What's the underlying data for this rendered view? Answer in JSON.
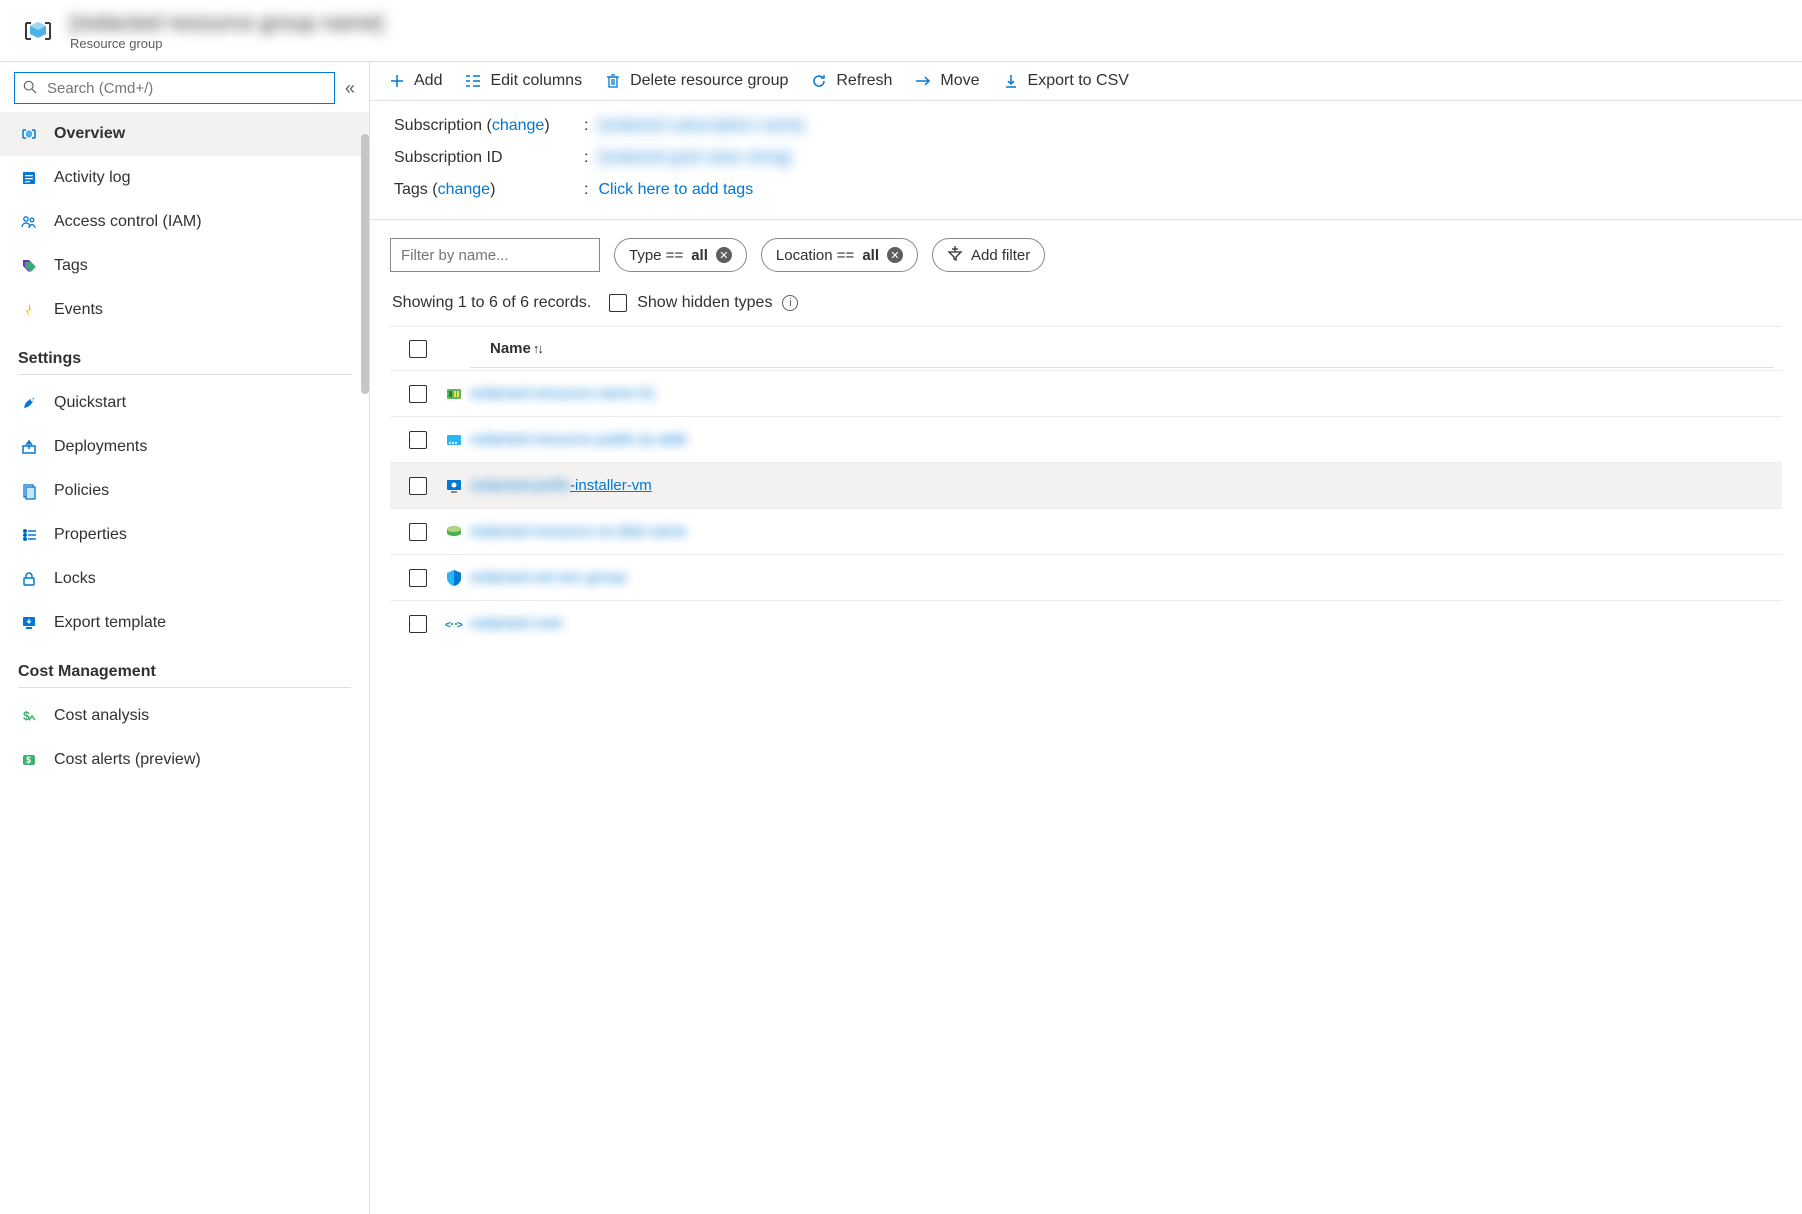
{
  "header": {
    "title": "[redacted resource group name]",
    "subtitle": "Resource group"
  },
  "search": {
    "placeholder": "Search (Cmd+/)"
  },
  "sidebar": {
    "items": [
      {
        "label": "Overview",
        "icon": "overview",
        "active": true
      },
      {
        "label": "Activity log",
        "icon": "activity-log"
      },
      {
        "label": "Access control (IAM)",
        "icon": "iam"
      },
      {
        "label": "Tags",
        "icon": "tags"
      },
      {
        "label": "Events",
        "icon": "events"
      }
    ],
    "sections": [
      {
        "title": "Settings",
        "items": [
          {
            "label": "Quickstart",
            "icon": "quickstart"
          },
          {
            "label": "Deployments",
            "icon": "deployments"
          },
          {
            "label": "Policies",
            "icon": "policies"
          },
          {
            "label": "Properties",
            "icon": "properties"
          },
          {
            "label": "Locks",
            "icon": "locks"
          },
          {
            "label": "Export template",
            "icon": "export-template"
          }
        ]
      },
      {
        "title": "Cost Management",
        "items": [
          {
            "label": "Cost analysis",
            "icon": "cost-analysis"
          },
          {
            "label": "Cost alerts (preview)",
            "icon": "cost-alerts"
          }
        ]
      }
    ]
  },
  "toolbar": {
    "add": "Add",
    "edit_columns": "Edit columns",
    "delete": "Delete resource group",
    "refresh": "Refresh",
    "move": "Move",
    "export_csv": "Export to CSV"
  },
  "props": {
    "subscription_label_pre": "Subscription (",
    "subscription_label_change": "change",
    "subscription_label_post": ")",
    "subscription_value": "[redacted subscription name]",
    "subscription_id_label": "Subscription ID",
    "subscription_id_value": "[redacted guid value string]",
    "tags_label_pre": "Tags (",
    "tags_label_change": "change",
    "tags_label_post": ")",
    "tags_value": "Click here to add tags"
  },
  "filters": {
    "filter_placeholder": "Filter by name...",
    "type_prefix": "Type == ",
    "type_value": "all",
    "location_prefix": "Location == ",
    "location_value": "all",
    "add_filter": "Add filter"
  },
  "records_text": "Showing 1 to 6 of 6 records.",
  "show_hidden": "Show hidden types",
  "table": {
    "name_header": "Name",
    "rows": [
      {
        "icon": "nic",
        "name_blur": "redacted-resource-name-01",
        "name_visible": ""
      },
      {
        "icon": "ip",
        "name_blur": "redacted-resource-public-ip-addr",
        "name_visible": ""
      },
      {
        "icon": "vm",
        "name_blur": "redacted-prefix",
        "name_visible": "-installer-vm",
        "hover": true
      },
      {
        "icon": "disk",
        "name_blur": "redacted-resource-os-disk-name",
        "name_visible": ""
      },
      {
        "icon": "nsg",
        "name_blur": "redacted-net-sec-group",
        "name_visible": ""
      },
      {
        "icon": "vnet",
        "name_blur": "redacted-vnet",
        "name_visible": ""
      }
    ]
  }
}
